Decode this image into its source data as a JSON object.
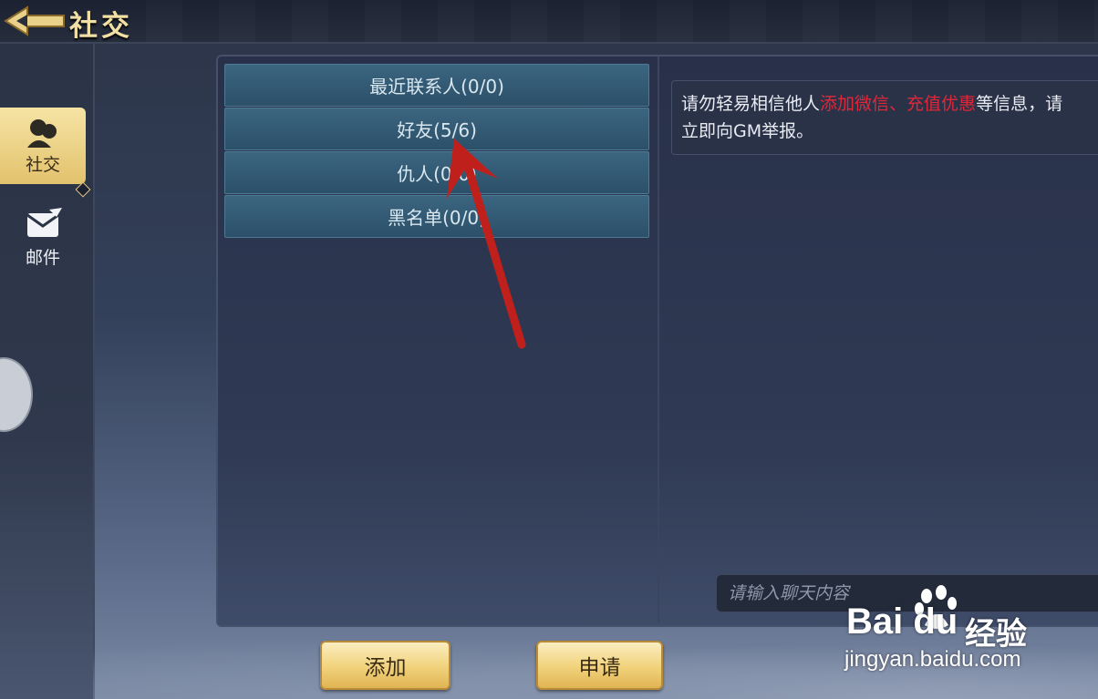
{
  "header": {
    "title": "社交",
    "back_icon": "back-arrow-icon"
  },
  "sidebar": {
    "items": [
      {
        "label": "社交",
        "icon": "social-icon",
        "active": true
      },
      {
        "label": "邮件",
        "icon": "mail-icon",
        "active": false
      }
    ]
  },
  "contacts": {
    "items": [
      {
        "label": "最近联系人(0/0)"
      },
      {
        "label": "好友(5/6)"
      },
      {
        "label": "仇人(0/0)"
      },
      {
        "label": "黑名单(0/0)"
      }
    ]
  },
  "notice": {
    "part1": "请勿轻易相信他人",
    "red1": "添加微信",
    "sep": "、",
    "red2": "充值优惠",
    "part2": "等信息，请",
    "line2": "立即向GM举报。"
  },
  "chat": {
    "placeholder": "请输入聊天内容"
  },
  "buttons": {
    "add_label": "添加",
    "apply_label": "申请"
  },
  "watermark": {
    "brand": "Bai du",
    "sub": "经验",
    "url": "jingyan.baidu.com"
  },
  "colors": {
    "accent_gold": "#f1d27b",
    "warning_red": "#e0273a",
    "list_blue": "#3b6580"
  }
}
